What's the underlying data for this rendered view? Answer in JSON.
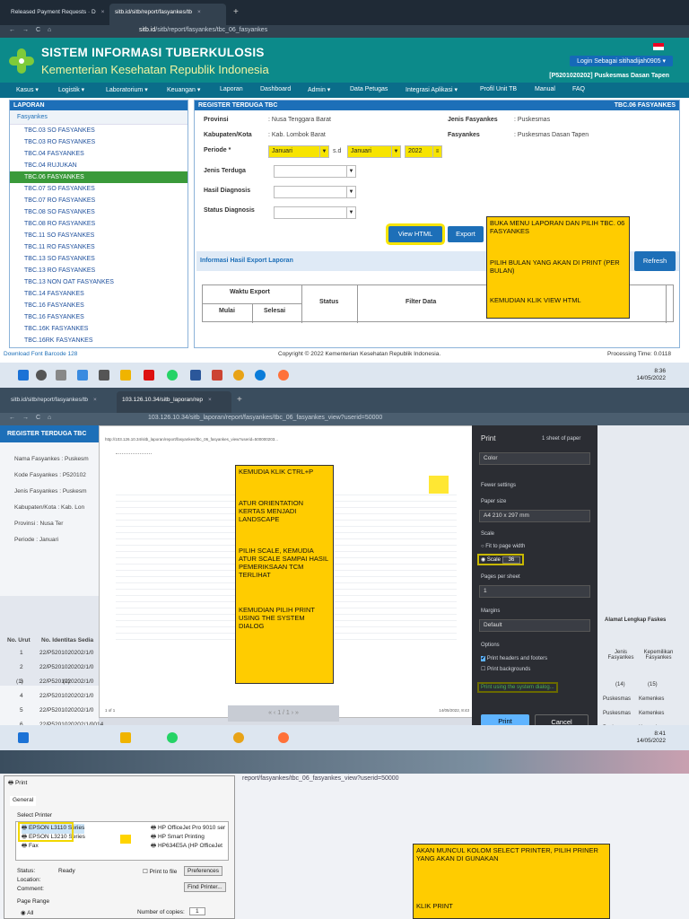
{
  "p1": {
    "tabs": [
      {
        "label": "Released Payment Requests · D",
        "close": "×"
      },
      {
        "label": "sitb.id/sitb/report/fasyankes/tb",
        "close": "×"
      }
    ],
    "url_host": "sitb.id",
    "url_path": "/sitb/report/fasyankes/tbc_06_fasyankes",
    "site_title": "SISTEM INFORMASI TUBERKULOSIS",
    "site_subtitle": "Kementerian Kesehatan Republik Indonesia",
    "login": "Login Sebagai sitihadijah0905 ▾",
    "puskesmas": "[P5201020202] Puskesmas Dasan Tapen",
    "menu": [
      "Kasus ▾",
      "Logistik ▾",
      "Laboratorium ▾",
      "Keuangan ▾",
      "Laporan",
      "Dashboard",
      "Admin ▾",
      "Data Petugas",
      "Integrasi Aplikasi ▾",
      "Profil Unit TB",
      "Manual",
      "FAQ"
    ],
    "sidebar_title": "LAPORAN",
    "sidebar_sub": "Fasyankes",
    "sidebar_items": [
      "TBC.03 SO FASYANKES",
      "TBC.03 RO FASYANKES",
      "TBC.04 FASYANKES",
      "TBC.04 RUJUKAN",
      "TBC.06 FASYANKES",
      "TBC.07 SO FASYANKES",
      "TBC.07 RO FASYANKES",
      "TBC.08 SO FASYANKES",
      "TBC.08 RO FASYANKES",
      "TBC.11 SO FASYANKES",
      "TBC.11 RO FASYANKES",
      "TBC.13 SO FASYANKES",
      "TBC.13 RO FASYANKES",
      "TBC.13 NON OAT FASYANKES",
      "TBC.14 FASYANKES",
      "TBC.16 FASYANKES",
      "TBC.16 FASYANKES",
      "TBC.16K FASYANKES",
      "TBC.16RK FASYANKES"
    ],
    "main_title": "REGISTER TERDUGA TBC",
    "main_code": "TBC.06 FASYANKES",
    "form": {
      "provinsi_label": "Provinsi",
      "provinsi": ": Nusa Tenggara Barat",
      "kab_label": "Kabupaten/Kota",
      "kab": ": Kab. Lombok Barat",
      "periode_label": "Periode *",
      "from": "Januari",
      "sd": "s.d",
      "to": "Januari",
      "year": "2022",
      "jenis_fas_label": "Jenis Fasyankes",
      "jenis_fas": ": Puskesmas",
      "fas_label": "Fasyankes",
      "fas": ": Puskesmas Dasan Tapen",
      "jenis_terduga": "Jenis Terduga",
      "hasil": "Hasil Diagnosis",
      "status": "Status Diagnosis"
    },
    "btn_view": "View HTML",
    "btn_export": "Export",
    "btn_refresh": "Refresh",
    "note": [
      "BUKA MENU LAPORAN DAN PILIH TBC. 06 FASYANKES",
      "PILIH BULAN YANG AKAN DI PRINT (PER BULAN)",
      "KEMUDIAN KLIK VIEW HTML"
    ],
    "export_title": "Informasi Hasil Export Laporan",
    "table": {
      "waktu": "Waktu Export",
      "mulai": "Mulai",
      "selesai": "Selesai",
      "status": "Status",
      "filter": "Filter Data"
    },
    "footer_left": "Download Font Barcode 128",
    "footer_mid": "Copyright © 2022 Kementerian Kesehatan Republik Indonesia.",
    "footer_right": "Processing Time: 0.0118",
    "clock_time": "8:36",
    "clock_date": "14/05/2022"
  },
  "p2": {
    "tabs": [
      {
        "label": "sitb.id/sitb/report/fasyankes/tb",
        "close": "×"
      },
      {
        "label": "103.126.10.34/sitb_laporan/rep",
        "close": "×"
      }
    ],
    "url": "103.126.10.34/sitb_laporan/report/fasyankes/tbc_06_fasyankes_view?userid=50000",
    "reg_title": "REGISTER TERDUGA TBC",
    "reg_rows": [
      "Nama Fasyankes : Puskesm",
      "Kode Fasyankes : P520102",
      "Jenis Fasyankes : Puskesm",
      "Kabupaten/Kota : Kab. Lon",
      "Provinsi : Nusa Ter",
      "Periode : Januari"
    ],
    "preview_header_left": "http://103.126.10.34/sitb_laporan/report/fasyankes/tbc_06_fasyankes_view?userid=500000203...",
    "preview_page": "1 of 1",
    "preview_date": "14/05/2022, 8:43",
    "note": [
      "KEMUDIA KLIK CTRL+P",
      "ATUR ORIENTATION KERTAS MENJADI LANDSCAPE",
      "PILIH SCALE, KEMUDIA ATUR SCALE SAMPAI HASIL PEMERIKSAAN TCM TERLIHAT",
      "KEMUDIAN PILIH PRINT USING THE SYSTEM DIALOG"
    ],
    "dialog": {
      "title": "Print",
      "sheets": "1 sheet of paper",
      "color": "Color",
      "fewer": "Fewer settings",
      "paper_label": "Paper size",
      "paper": "A4 210 x 297 mm",
      "scale_label": "Scale",
      "fit": "Fit to page width",
      "scale_opt": "Scale",
      "scale_val": "36",
      "pps_label": "Pages per sheet",
      "pps": "1",
      "margins_label": "Margins",
      "margins": "Default",
      "options_label": "Options",
      "opt1": "Print headers and footers",
      "opt2": "Print backgrounds",
      "system": "Print using the system dialog...",
      "print": "Print",
      "cancel": "Cancel"
    },
    "right_header": "Alamat Lengkap Faskes",
    "right_cols": [
      "Jenis Fasyankes",
      "Kepemilikan Fasyankes"
    ],
    "right_nums": [
      "(14)",
      "(15)"
    ],
    "rows": [
      {
        "n": "1",
        "id": "22/P5201020202/1/0"
      },
      {
        "n": "2",
        "id": "22/P5201020202/1/0"
      },
      {
        "n": "3",
        "id": "22/P5201020202/1/0"
      },
      {
        "n": "4",
        "id": "22/P5201020202/1/0"
      },
      {
        "n": "5",
        "id": "22/P5201020202/1/0"
      },
      {
        "n": "6",
        "id": "22/P5201020202/1/0014"
      }
    ],
    "col_no": "No. Urut",
    "col_id": "No. Identitas Sedia",
    "col_nums": [
      "(1)",
      "(2)"
    ],
    "row_right": [
      "Puskesmas",
      "Kemenkes"
    ],
    "pager": "1 / 1",
    "clock_time": "8:41",
    "clock_date": "14/05/2022"
  },
  "p3": {
    "dialog_title": "Print",
    "general": "General",
    "select_printer": "Select Printer",
    "printers": [
      "EPSON L3110 Series",
      "EPSON L3210 Series",
      "Fax",
      "HP OfficeJet Pro 9010 ser",
      "HP Smart Printing",
      "HP634E5A (HP OfficeJet"
    ],
    "status_label": "Status:",
    "status": "Ready",
    "location_label": "Location:",
    "comment_label": "Comment:",
    "print_to_file": "Print to file",
    "preferences": "Preferences",
    "find_printer": "Find Printer...",
    "page_range": "Page Range",
    "all": "All",
    "copies_label": "Number of copies:",
    "copies": "1",
    "url": "report/fasyankes/tbc_06_fasyankes_view?userid=50000",
    "note": [
      "AKAN MUNCUL KOLOM SELECT PRINTER, PILIH PRINER YANG AKAN DI GUNAKAN",
      "KLIK PRINT"
    ]
  }
}
